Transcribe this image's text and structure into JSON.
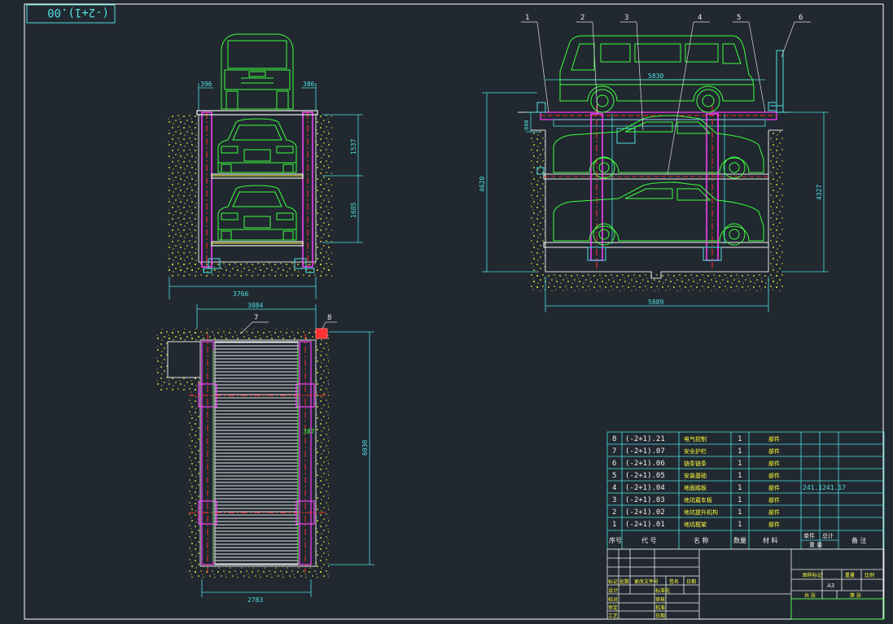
{
  "title_code": "(-2+1).00",
  "colors": {
    "background": "#212830",
    "border": "#ffffff",
    "cyan": "#4fe0e0",
    "green": "#3dff3d",
    "red": "#ff3030",
    "magenta": "#ff40ff",
    "yellow": "#ffff3a",
    "white": "#f2f2f2"
  },
  "front_view": {
    "dim_top_left": "396",
    "dim_top_right": "386",
    "dim_level1": "1537",
    "dim_level2": "1685",
    "dim_width": "3766"
  },
  "side_view": {
    "callouts": [
      "1",
      "2",
      "3",
      "4",
      "5",
      "6"
    ],
    "dim_car_length": "5830",
    "dim_small": "800",
    "dim_total_height": "4620",
    "dim_pit_depth": "4327",
    "dim_length": "5889"
  },
  "plan_view": {
    "dim_outer_width": "3084",
    "dim_inner_width": "2783",
    "dim_length": "6030",
    "dim_post": "387",
    "callout_7": "7",
    "callout_8": "8"
  },
  "bom": {
    "rows": [
      {
        "seq": "8",
        "code": "(-2+1).21",
        "name": "电气控制",
        "qty": "1",
        "material": "",
        "type": "部件",
        "weight": "",
        "note": ""
      },
      {
        "seq": "7",
        "code": "(-2+1).07",
        "name": "安全护栏",
        "qty": "1",
        "material": "",
        "type": "部件",
        "weight": "",
        "note": ""
      },
      {
        "seq": "6",
        "code": "(-2+1).06",
        "name": "链条链条",
        "qty": "1",
        "material": "",
        "type": "部件",
        "weight": "",
        "note": ""
      },
      {
        "seq": "5",
        "code": "(-2+1).05",
        "name": "安装基础",
        "qty": "1",
        "material": "",
        "type": "部件",
        "weight": "",
        "note": ""
      },
      {
        "seq": "4",
        "code": "(-2+1).04",
        "name": "地面踏板",
        "qty": "1",
        "material": "",
        "type": "部件",
        "weight": "241.1|241.17",
        "note": ""
      },
      {
        "seq": "3",
        "code": "(-2+1).03",
        "name": "地坑载车板",
        "qty": "1",
        "material": "",
        "type": "部件",
        "weight": "",
        "note": ""
      },
      {
        "seq": "2",
        "code": "(-2+1).02",
        "name": "地坑提升机构",
        "qty": "1",
        "material": "",
        "type": "部件",
        "weight": "",
        "note": ""
      },
      {
        "seq": "1",
        "code": "(-2+1).01",
        "name": "地坑框架",
        "qty": "1",
        "material": "",
        "type": "部件",
        "weight": "",
        "note": ""
      }
    ],
    "header": {
      "seq": "序号",
      "code": "代 号",
      "name": "名 称",
      "qty": "数量",
      "material": "材 料",
      "unit_top": "单件",
      "total_top": "总计",
      "weight": "重 量",
      "note": "备 注"
    }
  },
  "title_block": {
    "cells": [
      "标记",
      "处数",
      "更改文件号",
      "签名",
      "日期",
      "设计",
      "标准化",
      "校对",
      "审核",
      "审定",
      "工艺",
      "批准",
      "日期"
    ],
    "stage": "图样标记",
    "weight_label": "重量",
    "scale_label": "比例",
    "format": "A3",
    "sheet": "共 张",
    "sheet2": "第 张"
  }
}
